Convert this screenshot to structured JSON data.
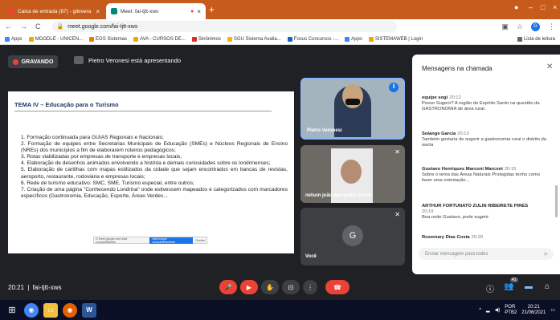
{
  "browser": {
    "tabs": [
      {
        "label": "Caixa de entrada (87) - gilevera",
        "active": false
      },
      {
        "label": "Meet: fai-tjtt-xws",
        "active": true
      }
    ],
    "url": "meet.google.com/fai-tjtt-xws",
    "bookmarks": [
      "Apps",
      "MOODLE - UNICEN...",
      "EGS Sistemas",
      "AVA - CURSOS DE...",
      "Sinônimos",
      "SGU Sistema Avalia...",
      "Focus Concursos -...",
      "Apps",
      "SISTEMAWEB | Login"
    ],
    "reading_list": "Lista de leitura"
  },
  "meet": {
    "recording_label": "GRAVANDO",
    "presenting_text": "Pietro Veronesi está apresentando",
    "meeting_code": "fai-tjtt-xws",
    "clock": "20:21",
    "participants_count": "41"
  },
  "slide": {
    "title": "TEMA IV – Educação para o Turismo",
    "items": [
      "1. Formação continuada para GUIAS Regionais e Nacionais;",
      "2. Formação de equipes entre Secretarias Municipais de Educação (SMEs) e Núcleos Regionais de Ensino (NREs) dos municípios a fim de elaborarem roteiros pedagógicos;",
      "3. Rotas viabilizadas por empresas de transporte e empresas locais;",
      "4. Elaboração de desenhos animados envolvendo a história e demais curiosidades sobre os londrinenses;",
      "5. Elaboração de cartilhas com mapas estilizados da cidade que sejam encontrados em bancas de revistas, aeroporto, restaurante, rodoviária e empresas locais;",
      "6. Rede de turismo educativo: SMC, SME, Turismo especial, entre outros;",
      "7. Criação de uma página \"Conhecendo Londrina\" onde estivessem mapeados e categorizados com marcadores específicos (Gastronomia, Educação, Esporte, Áreas Verdes..."
    ],
    "share_bar_text": "O meet.google.com está compartilhando",
    "share_bar_button": "Interromper compartilhamento",
    "share_bar_hide": "Ocultar"
  },
  "tiles": [
    {
      "name": "Pietro Veronesi"
    },
    {
      "name": "nelson joão sperandio júnior"
    },
    {
      "name": "Você",
      "initial": "G"
    }
  ],
  "chat": {
    "title": "Mensagens na chamada",
    "messages": [
      {
        "sender": "equipe sogi",
        "time": "20:12",
        "text": "Posso Sugerir? A região do Espírito Santo na questão da GASTRONOMIA de área rural."
      },
      {
        "sender": "Solange Garcia",
        "time": "20:13",
        "text": "Também gostaria de sugerir a gastronomia rural o distrito da warta"
      },
      {
        "sender": "Gustavo Henriques Marconi Marconi",
        "time": "20:15",
        "text": "Sobre o tema das Áreas Naturais Protegidas tenho como fazer uma orientação..."
      },
      {
        "sender": "ARTHUR FORTUNATO ZULIN RIBEIRETE PIRES",
        "time": "20:19",
        "text": "Boa noite Gustavo, pode sugerir"
      },
      {
        "sender": "Rosemary Dias Costa",
        "time": "20:20",
        "text": ""
      }
    ],
    "input_placeholder": "Enviar mensagem para todos"
  },
  "taskbar": {
    "lang": "POR",
    "layout": "PTB2",
    "time": "20:21",
    "date": "21/06/2021"
  }
}
